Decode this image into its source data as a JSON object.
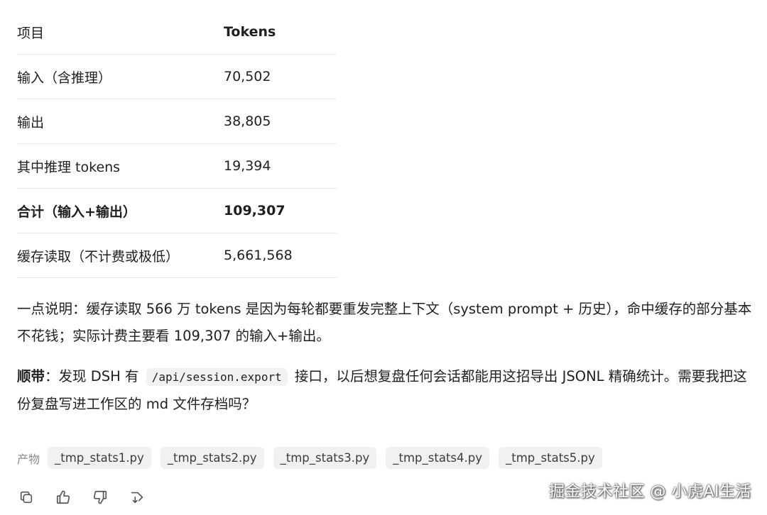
{
  "table": {
    "headers": [
      "项目",
      "Tokens"
    ],
    "rows": [
      {
        "label": "输入（含推理）",
        "value": "70,502"
      },
      {
        "label": "输出",
        "value": "38,805"
      },
      {
        "label": "其中推理 tokens",
        "value": "19,394"
      },
      {
        "label": "合计（输入+输出）",
        "value": "109,307"
      },
      {
        "label": "缓存读取（不计费或极低）",
        "value": "5,661,568"
      }
    ]
  },
  "note": {
    "text": "一点说明：缓存读取 566 万 tokens 是因为每轮都要重发完整上下文（system prompt + 历史），命中缓存的部分基本不花钱；实际计费主要看 109,307 的输入+输出。"
  },
  "tip": {
    "bold": "顺带",
    "before": "：发现 DSH 有",
    "code": "/api/session.export",
    "after": "接口，以后想复盘任何会话都能用这招导出 JSONL 精确统计。需要我把这份复盘写进工作区的 md 文件存档吗？"
  },
  "artifacts": {
    "label": "产物",
    "files": [
      "_tmp_stats1.py",
      "_tmp_stats2.py",
      "_tmp_stats3.py",
      "_tmp_stats4.py",
      "_tmp_stats5.py"
    ]
  },
  "actions": [
    "copy-icon",
    "thumbs-up-icon",
    "thumbs-down-icon",
    "share-icon"
  ],
  "watermark": "掘金技术社区 @ 小虎AI生活"
}
